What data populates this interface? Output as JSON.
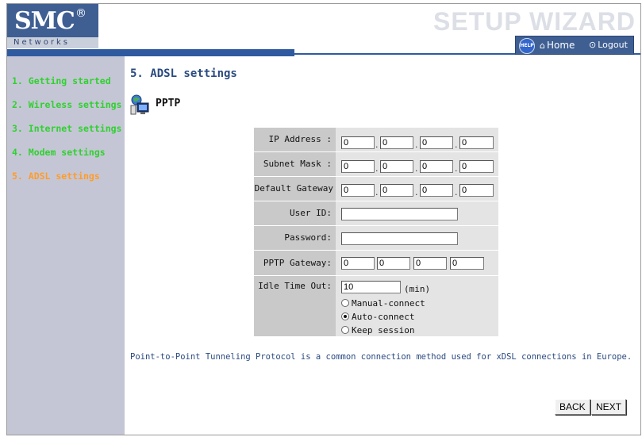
{
  "header": {
    "logo_text": "SMC",
    "logo_reg": "®",
    "logo_sub": "Networks",
    "wizard_title": "SETUP WIZARD",
    "help_label": "HELP",
    "home_label": "Home",
    "logout_label": "Logout"
  },
  "sidebar": {
    "items": [
      {
        "label": "1. Getting started",
        "active": false
      },
      {
        "label": "2. Wireless settings",
        "active": false
      },
      {
        "label": "3. Internet settings",
        "active": false
      },
      {
        "label": "4. Modem settings",
        "active": false
      },
      {
        "label": "5. ADSL settings",
        "active": true
      }
    ]
  },
  "main": {
    "page_title": "5. ADSL settings",
    "section_label": "PPTP",
    "form": {
      "ip_address_label": "IP Address :",
      "ip_address": [
        "0",
        "0",
        "0",
        "0"
      ],
      "subnet_mask_label": "Subnet Mask :",
      "subnet_mask": [
        "0",
        "0",
        "0",
        "0"
      ],
      "default_gateway_label": "Default Gateway :",
      "default_gateway": [
        "0",
        "0",
        "0",
        "0"
      ],
      "user_id_label": "User ID:",
      "user_id": "",
      "password_label": "Password:",
      "password": "",
      "pptp_gateway_label": "PPTP Gateway:",
      "pptp_gateway": [
        "0",
        "0",
        "0",
        "0"
      ],
      "idle_timeout_label": "Idle Time Out:",
      "idle_timeout": "10",
      "idle_timeout_unit": "(min)",
      "connect_options": [
        {
          "label": "Manual-connect",
          "selected": false
        },
        {
          "label": "Auto-connect",
          "selected": true
        },
        {
          "label": "Keep session",
          "selected": false
        }
      ]
    },
    "description": "Point-to-Point Tunneling Protocol is a common connection method used for xDSL connections in Europe.",
    "back_label": "BACK",
    "next_label": "NEXT"
  },
  "colors": {
    "header_blue": "#3f5f93",
    "sidebar_bg": "#c5c6d5",
    "nav_green": "#2fd12f",
    "nav_active_orange": "#ff9c2a",
    "title_blue": "#2a4a80"
  }
}
